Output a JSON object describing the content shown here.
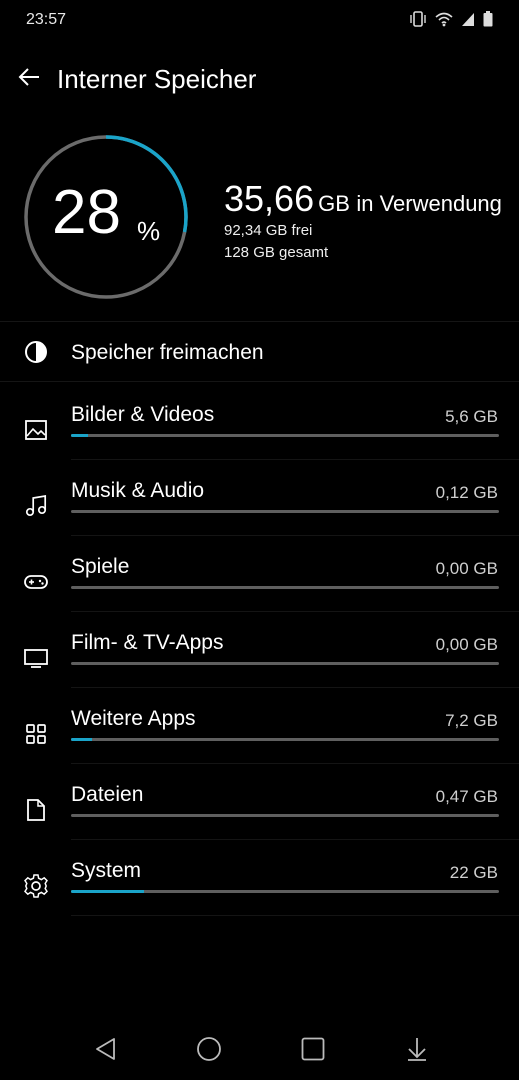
{
  "status": {
    "time": "23:57"
  },
  "header": {
    "title": "Interner Speicher"
  },
  "summary": {
    "percent": "28",
    "percent_sign": "%",
    "used_value": "35,66",
    "used_unit": "GB",
    "used_label": "in Verwendung",
    "free": "92,34 GB frei",
    "total": "128 GB gesamt",
    "used_fraction": 0.28,
    "accent_color": "#1aa4c9"
  },
  "freeup": {
    "label": "Speicher freimachen",
    "icon": "storage-pie-icon"
  },
  "categories": [
    {
      "label": "Bilder & Videos",
      "size": "5,6 GB",
      "icon": "image-icon",
      "fraction": 0.04
    },
    {
      "label": "Musik & Audio",
      "size": "0,12 GB",
      "icon": "music-note-icon",
      "fraction": 0.0
    },
    {
      "label": "Spiele",
      "size": "0,00 GB",
      "icon": "gamepad-icon",
      "fraction": 0.0
    },
    {
      "label": "Film- & TV-Apps",
      "size": "0,00 GB",
      "icon": "tv-icon",
      "fraction": 0.0
    },
    {
      "label": "Weitere Apps",
      "size": "7,2 GB",
      "icon": "apps-grid-icon",
      "fraction": 0.05
    },
    {
      "label": "Dateien",
      "size": "0,47 GB",
      "icon": "file-icon",
      "fraction": 0.0
    },
    {
      "label": "System",
      "size": "22 GB",
      "icon": "gear-icon",
      "fraction": 0.17
    }
  ]
}
